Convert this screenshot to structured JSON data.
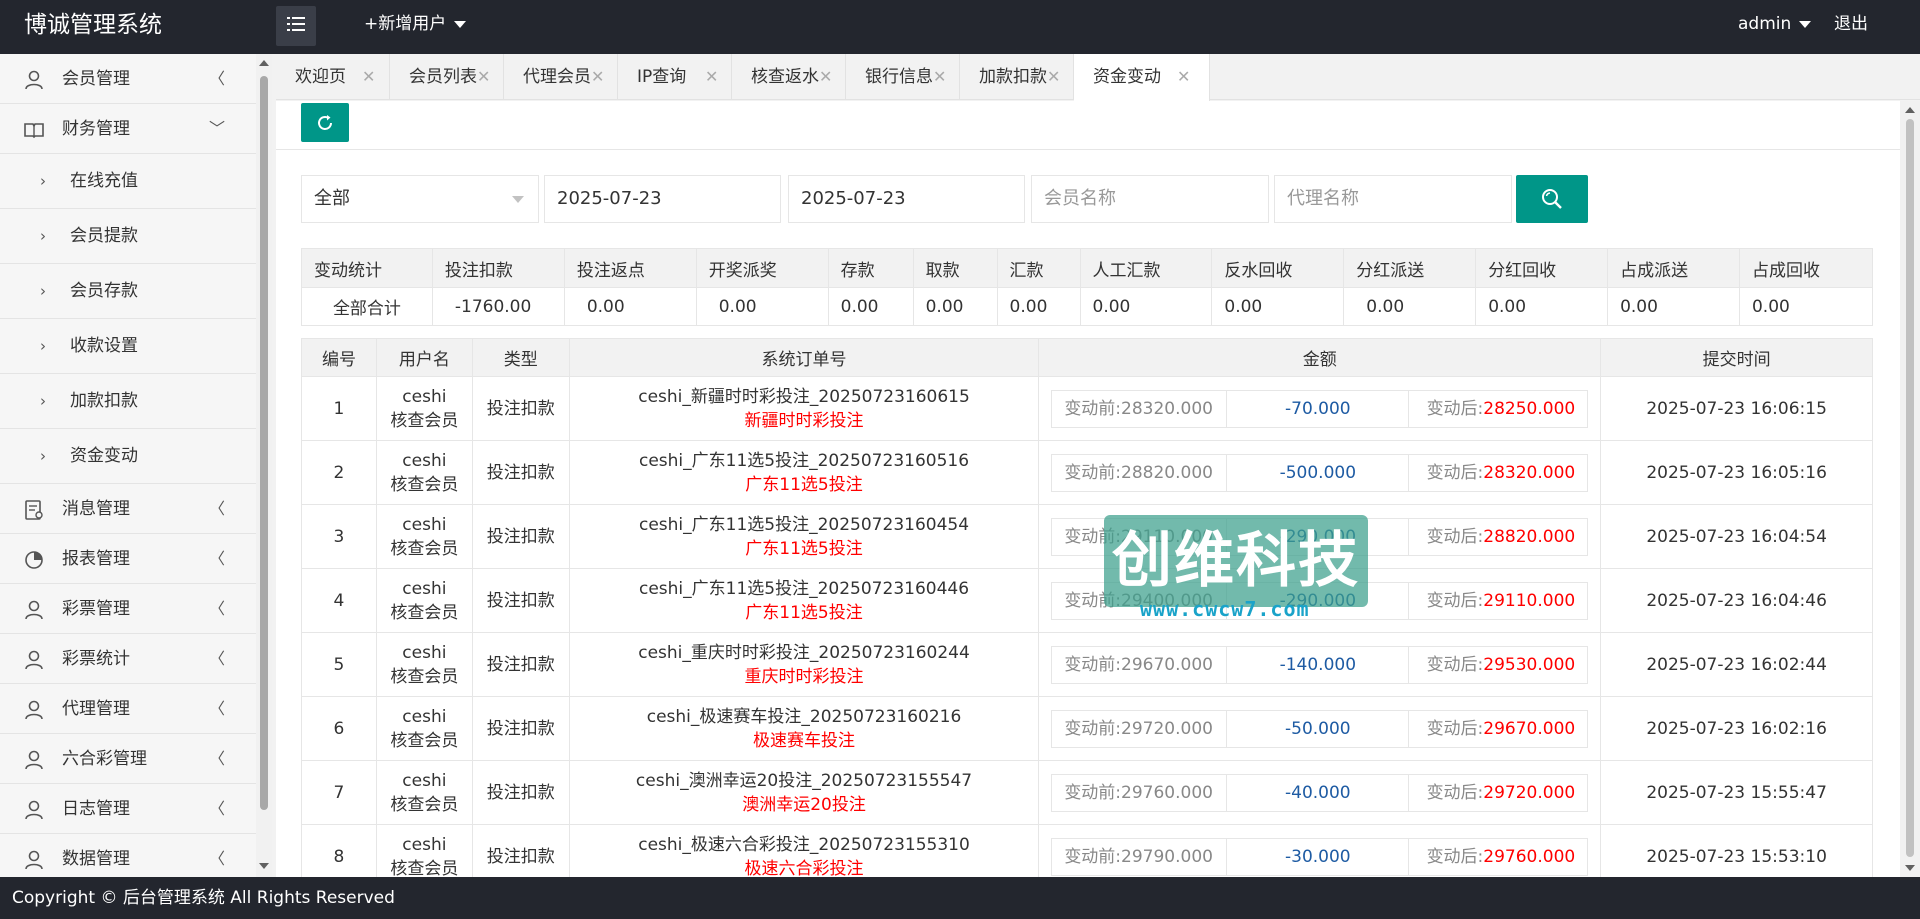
{
  "header": {
    "title": "博诚管理系统",
    "add_user": "+新增用户",
    "user": "admin",
    "logout": "退出"
  },
  "sidebar": {
    "items": [
      {
        "label": "会员管理",
        "icon": "user-icon"
      },
      {
        "label": "财务管理",
        "icon": "book-icon",
        "expanded": true
      },
      {
        "label": "消息管理",
        "icon": "message-icon"
      },
      {
        "label": "报表管理",
        "icon": "report-icon"
      },
      {
        "label": "彩票管理",
        "icon": "user-icon"
      },
      {
        "label": "彩票统计",
        "icon": "user-icon"
      },
      {
        "label": "代理管理",
        "icon": "user-icon"
      },
      {
        "label": "六合彩管理",
        "icon": "user-icon"
      },
      {
        "label": "日志管理",
        "icon": "user-icon"
      },
      {
        "label": "数据管理",
        "icon": "user-icon"
      }
    ],
    "sub_items": [
      "在线充值",
      "会员提款",
      "会员存款",
      "收款设置",
      "加款扣款",
      "资金变动"
    ]
  },
  "tabs": [
    "欢迎页",
    "会员列表",
    "代理会员",
    "IP查询",
    "核查返水",
    "银行信息",
    "加款扣款",
    "资金变动"
  ],
  "filters": {
    "type": "全部",
    "date_start": "2025-07-23",
    "date_end": "2025-07-23",
    "member_placeholder": "会员名称",
    "agent_placeholder": "代理名称"
  },
  "stats": {
    "headers": [
      "变动统计",
      "投注扣款",
      "投注返点",
      "开奖派奖",
      "存款",
      "取款",
      "汇款",
      "人工汇款",
      "反水回收",
      "分红派送",
      "分红回收",
      "占成派送",
      "占成回收"
    ],
    "row": [
      "全部合计",
      "-1760.00",
      "0.00",
      "0.00",
      "0.00",
      "0.00",
      "0.00",
      "0.00",
      "0.00",
      "0.00",
      "0.00",
      "0.00",
      "0.00"
    ]
  },
  "records": {
    "headers": [
      "编号",
      "用户名",
      "类型",
      "系统订单号",
      "金额",
      "提交时间"
    ],
    "rows": [
      {
        "id": "1",
        "user": "ceshi",
        "role": "核查会员",
        "type": "投注扣款",
        "order": "ceshi_新疆时时彩投注_20250723160615",
        "game": "新疆时时彩投注",
        "before_label": "变动前:",
        "before": "28320.000",
        "change": "-70.000",
        "after_label": "变动后:",
        "after": "28250.000",
        "time": "2025-07-23 16:06:15"
      },
      {
        "id": "2",
        "user": "ceshi",
        "role": "核查会员",
        "type": "投注扣款",
        "order": "ceshi_广东11选5投注_20250723160516",
        "game": "广东11选5投注",
        "before_label": "变动前:",
        "before": "28820.000",
        "change": "-500.000",
        "after_label": "变动后:",
        "after": "28320.000",
        "time": "2025-07-23 16:05:16"
      },
      {
        "id": "3",
        "user": "ceshi",
        "role": "核查会员",
        "type": "投注扣款",
        "order": "ceshi_广东11选5投注_20250723160454",
        "game": "广东11选5投注",
        "before_label": "变动前:",
        "before": "29110.000",
        "change": "-290.000",
        "after_label": "变动后:",
        "after": "28820.000",
        "time": "2025-07-23 16:04:54"
      },
      {
        "id": "4",
        "user": "ceshi",
        "role": "核查会员",
        "type": "投注扣款",
        "order": "ceshi_广东11选5投注_20250723160446",
        "game": "广东11选5投注",
        "before_label": "变动前:",
        "before": "29400.000",
        "change": "-290.000",
        "after_label": "变动后:",
        "after": "29110.000",
        "time": "2025-07-23 16:04:46"
      },
      {
        "id": "5",
        "user": "ceshi",
        "role": "核查会员",
        "type": "投注扣款",
        "order": "ceshi_重庆时时彩投注_20250723160244",
        "game": "重庆时时彩投注",
        "before_label": "变动前:",
        "before": "29670.000",
        "change": "-140.000",
        "after_label": "变动后:",
        "after": "29530.000",
        "time": "2025-07-23 16:02:44"
      },
      {
        "id": "6",
        "user": "ceshi",
        "role": "核查会员",
        "type": "投注扣款",
        "order": "ceshi_极速赛车投注_20250723160216",
        "game": "极速赛车投注",
        "before_label": "变动前:",
        "before": "29720.000",
        "change": "-50.000",
        "after_label": "变动后:",
        "after": "29670.000",
        "time": "2025-07-23 16:02:16"
      },
      {
        "id": "7",
        "user": "ceshi",
        "role": "核查会员",
        "type": "投注扣款",
        "order": "ceshi_澳洲幸运20投注_20250723155547",
        "game": "澳洲幸运20投注",
        "before_label": "变动前:",
        "before": "29760.000",
        "change": "-40.000",
        "after_label": "变动后:",
        "after": "29720.000",
        "time": "2025-07-23 15:55:47"
      },
      {
        "id": "8",
        "user": "ceshi",
        "role": "核查会员",
        "type": "投注扣款",
        "order": "ceshi_极速六合彩投注_20250723155310",
        "game": "极速六合彩投注",
        "before_label": "变动前:",
        "before": "29790.000",
        "change": "-30.000",
        "after_label": "变动后:",
        "after": "29760.000",
        "time": "2025-07-23 15:53:10"
      }
    ]
  },
  "watermark": {
    "text": "创维科技",
    "url": "www.cwcw7.com"
  },
  "footer": {
    "copyright": "Copyright © 后台管理系统 All Rights Reserved"
  },
  "colors": {
    "header_bg": "#23262e",
    "accent": "#009688",
    "negative": "#1e5ba3",
    "highlight": "#ff0000"
  }
}
